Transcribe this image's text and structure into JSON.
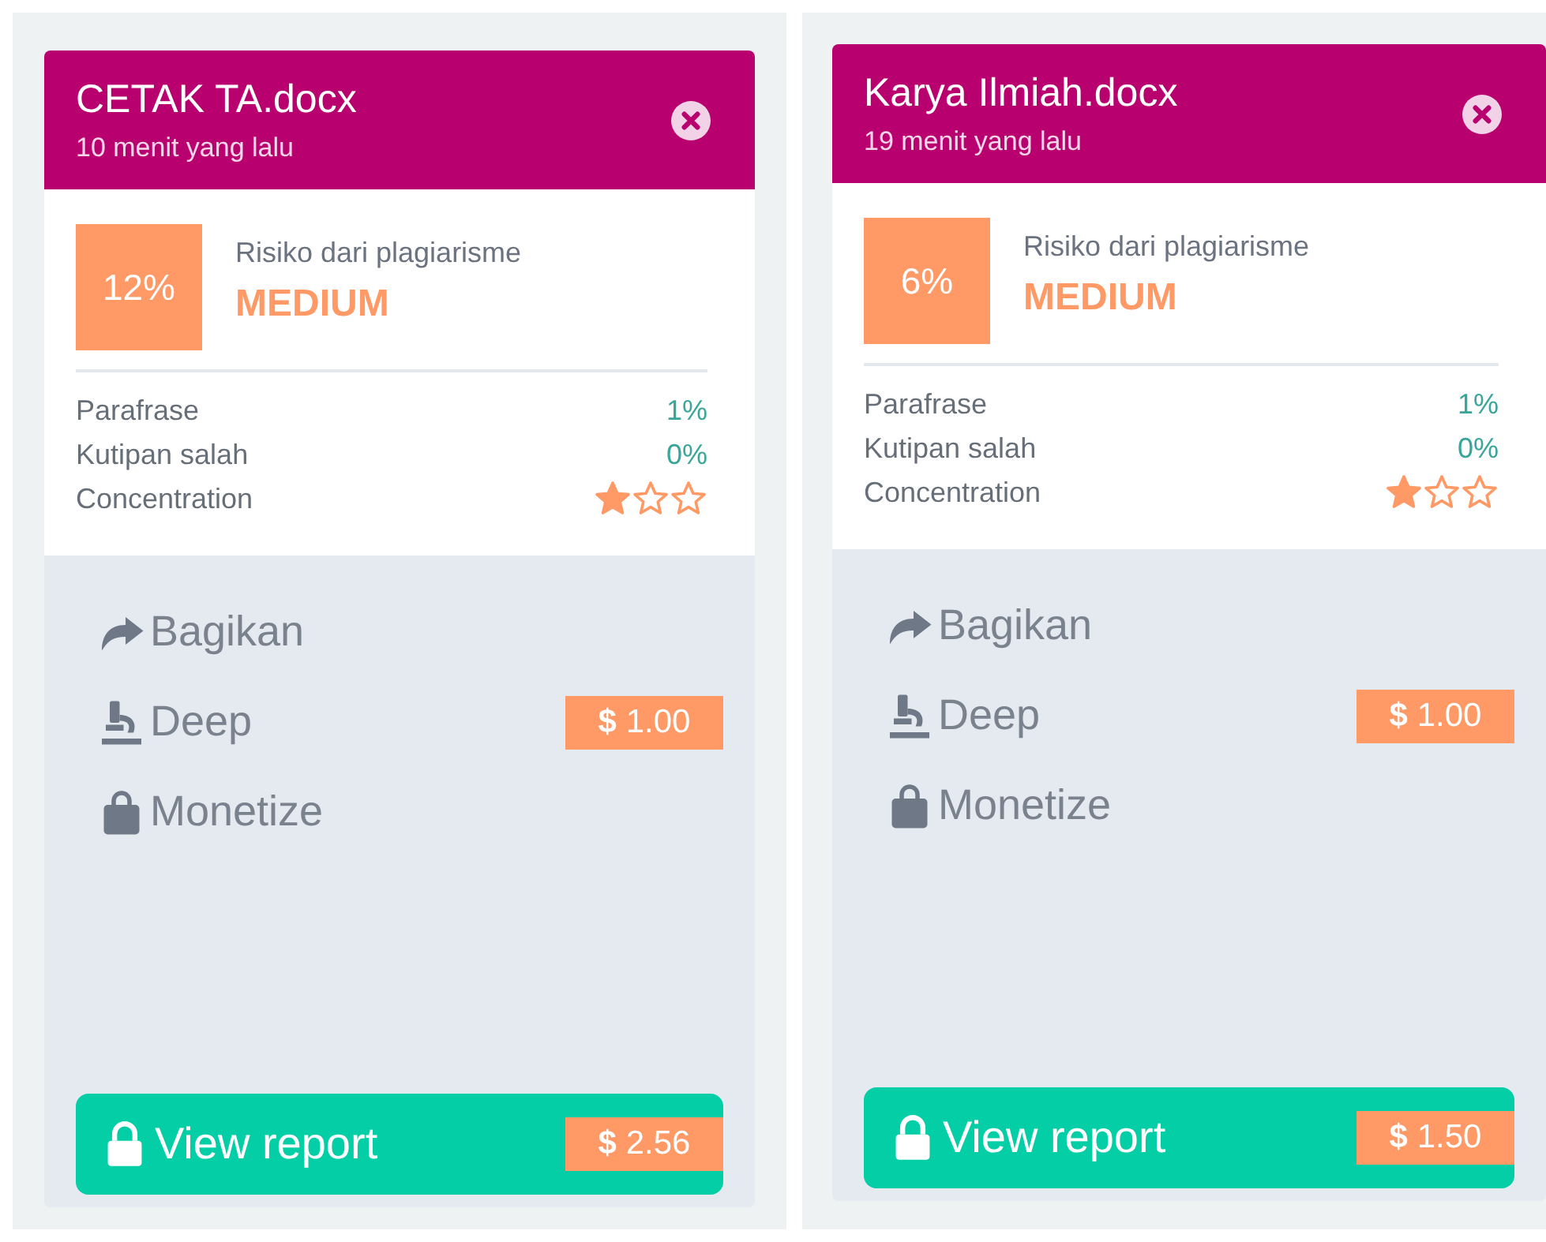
{
  "cards": [
    {
      "title": "CETAK TA.docx",
      "time": "10 menit yang lalu",
      "percent": "12%",
      "risk_label": "Risiko dari plagiarisme",
      "risk_level": "MEDIUM",
      "metrics": [
        {
          "kind": "value",
          "label": "Parafrase",
          "value": "1%"
        },
        {
          "kind": "value",
          "label": "Kutipan salah",
          "value": "0%"
        },
        {
          "kind": "stars",
          "label": "Concentration",
          "stars": 1
        }
      ],
      "actions": [
        {
          "kind": "share",
          "label": "Bagikan"
        },
        {
          "kind": "deep",
          "label": "Deep",
          "price": "**$** 1.00"
        },
        {
          "kind": "monetize",
          "label": "Monetize"
        }
      ],
      "report": {
        "label": "View report",
        "price": "**$** 2.56"
      }
    },
    {
      "title": "Karya Ilmiah.docx",
      "time": "19 menit yang lalu",
      "percent": "6%",
      "risk_label": "Risiko dari plagiarisme",
      "risk_level": "MEDIUM",
      "metrics": [
        {
          "kind": "value",
          "label": "Parafrase",
          "value": "1%"
        },
        {
          "kind": "value",
          "label": "Kutipan salah",
          "value": "0%"
        },
        {
          "kind": "stars",
          "label": "Concentration",
          "stars": 1
        }
      ],
      "actions": [
        {
          "kind": "share",
          "label": "Bagikan"
        },
        {
          "kind": "deep",
          "label": "Deep",
          "price": "**$** 1.00"
        },
        {
          "kind": "monetize",
          "label": "Monetize"
        }
      ],
      "report": {
        "label": "View report",
        "price": "**$** 1.50"
      }
    }
  ]
}
